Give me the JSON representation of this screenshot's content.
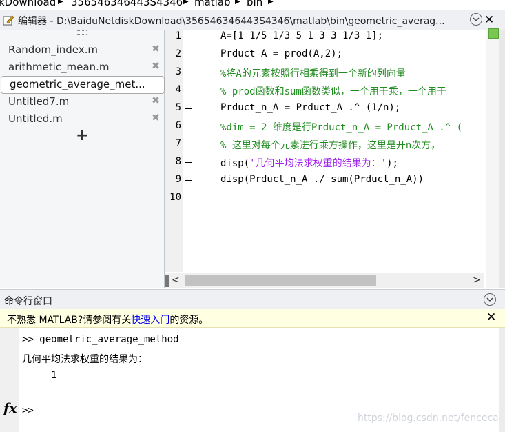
{
  "breadcrumb": [
    "kDownload",
    "356546346443S4346",
    "matlab",
    "bin"
  ],
  "editor": {
    "title": "编辑器 - D:\\BaiduNetdiskDownload\\356546346443S4346\\matlab\\bin\\geometric_averag...",
    "tabs": [
      {
        "label": "Random_index.m",
        "active": false
      },
      {
        "label": "arithmetic_mean.m",
        "active": false
      },
      {
        "label": "geometric_average_met...",
        "active": true
      },
      {
        "label": "Untitled7.m",
        "active": false
      },
      {
        "label": "Untitled.m",
        "active": false
      }
    ],
    "add_tab_label": "+",
    "lines": [
      {
        "n": "1",
        "dash": true,
        "code": "A=[1 1/5 1/3 5 1 3 3 1/3 1];",
        "kind": "code"
      },
      {
        "n": "2",
        "dash": true,
        "code": "Prduct_A = prod(A,2);",
        "kind": "code"
      },
      {
        "n": "3",
        "dash": false,
        "code": "%将A的元素按照行相乘得到一个新的列向量",
        "kind": "comment"
      },
      {
        "n": "4",
        "dash": false,
        "code": "% prod函数和sum函数类似，一个用于乘，一个用于",
        "kind": "comment"
      },
      {
        "n": "5",
        "dash": true,
        "code": "Prduct_n_A = Prduct_A .^ (1/n);",
        "kind": "code"
      },
      {
        "n": "6",
        "dash": false,
        "code": "%dim = 2 维度是行Prduct_n_A = Prduct_A .^ (",
        "kind": "comment"
      },
      {
        "n": "7",
        "dash": false,
        "code": "% 这里对每个元素进行乘方操作，这里是开n次方，",
        "kind": "comment"
      },
      {
        "n": "8",
        "dash": true,
        "code_pre": "disp(",
        "code_str": "'几何平均法求权重的结果为：'",
        "code_post": ");",
        "kind": "disp"
      },
      {
        "n": "9",
        "dash": true,
        "code": "disp(Prduct_n_A ./ sum(Prduct_n_A))",
        "kind": "code"
      },
      {
        "n": "10",
        "dash": false,
        "code": "",
        "kind": "code"
      }
    ]
  },
  "command_window": {
    "title": "命令行窗口",
    "info_pre": "不熟悉 MATLAB?请参阅有关",
    "info_link": "快速入门",
    "info_post": "的资源。",
    "lines": [
      ">> geometric_average_method",
      "几何平均法求权重的结果为：",
      "     1"
    ],
    "prompt": ">>",
    "fx_label": "fx",
    "watermark": "https://blog.csdn.net/fencecat"
  },
  "colors": {
    "comment": "#228b22",
    "string": "#a020f0",
    "link": "#0000ee",
    "info_bg": "#ffffe1"
  }
}
